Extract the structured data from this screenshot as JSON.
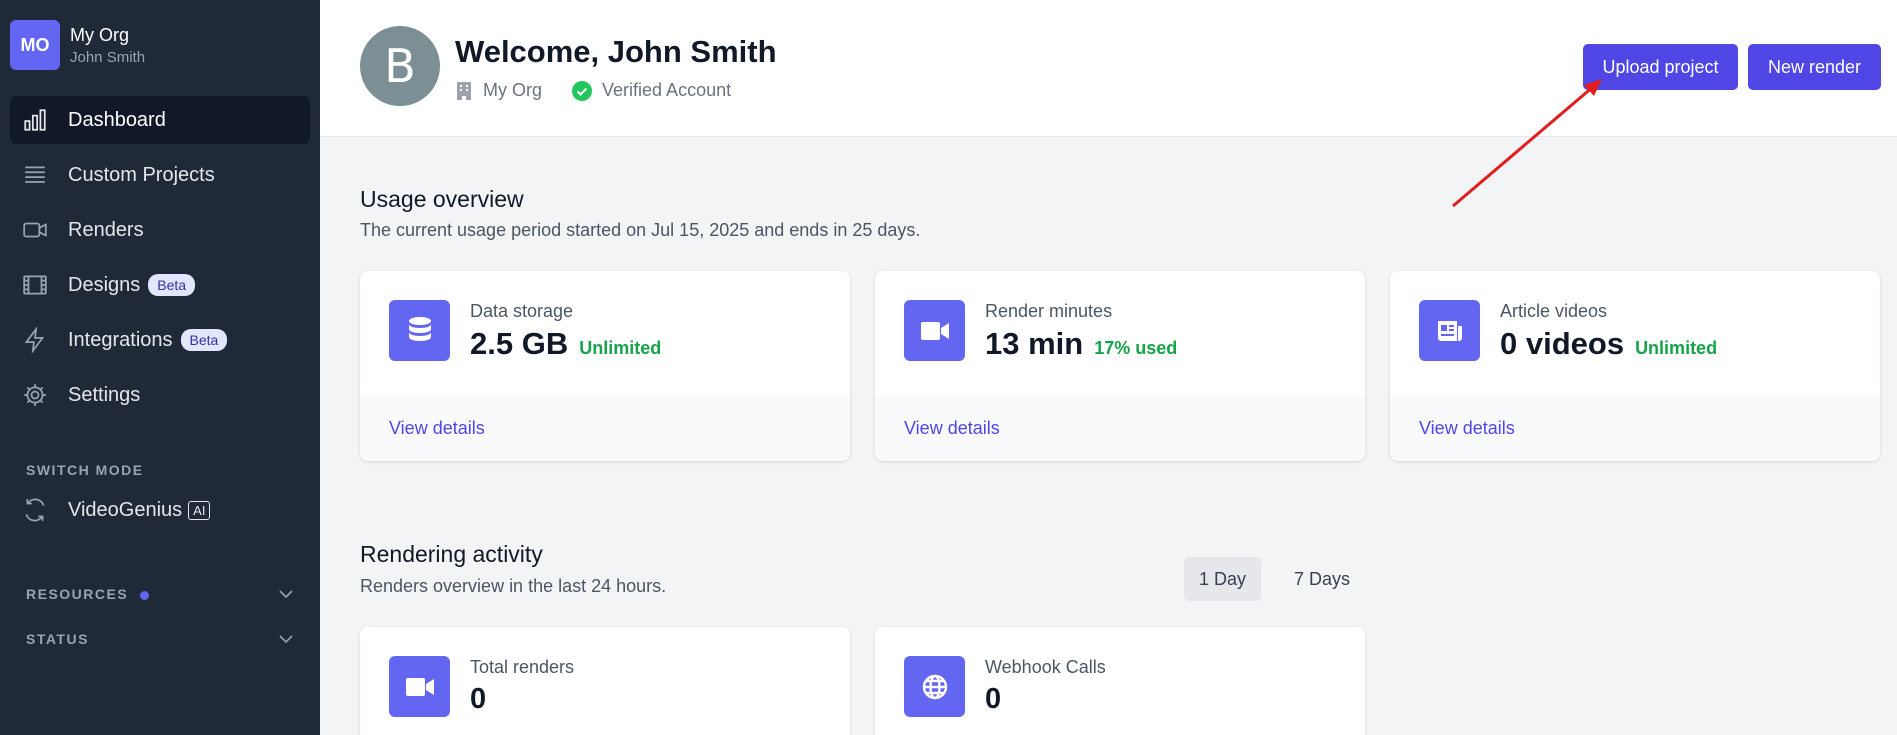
{
  "sidebar": {
    "org_initials": "MO",
    "org_name": "My Org",
    "user_name": "John Smith",
    "items": [
      {
        "label": "Dashboard",
        "icon": "bar-chart-icon",
        "active": true
      },
      {
        "label": "Custom Projects",
        "icon": "list-icon"
      },
      {
        "label": "Renders",
        "icon": "video-camera-icon"
      },
      {
        "label": "Designs",
        "icon": "film-icon",
        "badge": "Beta"
      },
      {
        "label": "Integrations",
        "icon": "lightning-icon",
        "badge": "Beta"
      },
      {
        "label": "Settings",
        "icon": "gear-icon"
      }
    ],
    "switch_mode_label": "SWITCH MODE",
    "switch_item": {
      "label": "VideoGenius",
      "badge": "AI",
      "icon": "refresh-icon"
    },
    "resources_label": "RESOURCES",
    "status_label": "STATUS"
  },
  "header": {
    "avatar_letter": "B",
    "welcome": "Welcome, John Smith",
    "org": "My Org",
    "verified": "Verified Account",
    "upload_label": "Upload project",
    "new_render_label": "New render"
  },
  "usage": {
    "title": "Usage overview",
    "subtitle": "The current usage period started on Jul 15, 2025 and ends in 25 days.",
    "cards": [
      {
        "label": "Data storage",
        "value": "2.5 GB",
        "tag": "Unlimited",
        "link": "View details",
        "icon": "database-icon"
      },
      {
        "label": "Render minutes",
        "value": "13 min",
        "tag": "17% used",
        "link": "View details",
        "icon": "video-camera-icon"
      },
      {
        "label": "Article videos",
        "value": "0 videos",
        "tag": "Unlimited",
        "link": "View details",
        "icon": "newspaper-icon"
      }
    ]
  },
  "activity": {
    "title": "Rendering activity",
    "subtitle": "Renders overview in the last 24 hours.",
    "ranges": [
      "1 Day",
      "7 Days"
    ],
    "cards": [
      {
        "label": "Total renders",
        "value": "0",
        "icon": "video-camera-icon"
      },
      {
        "label": "Webhook Calls",
        "value": "0",
        "icon": "globe-icon"
      }
    ]
  },
  "colors": {
    "accent": "#4f46e5",
    "sidebar": "#1f2937",
    "success": "#16a34a",
    "annotation": "#e11d1d"
  }
}
